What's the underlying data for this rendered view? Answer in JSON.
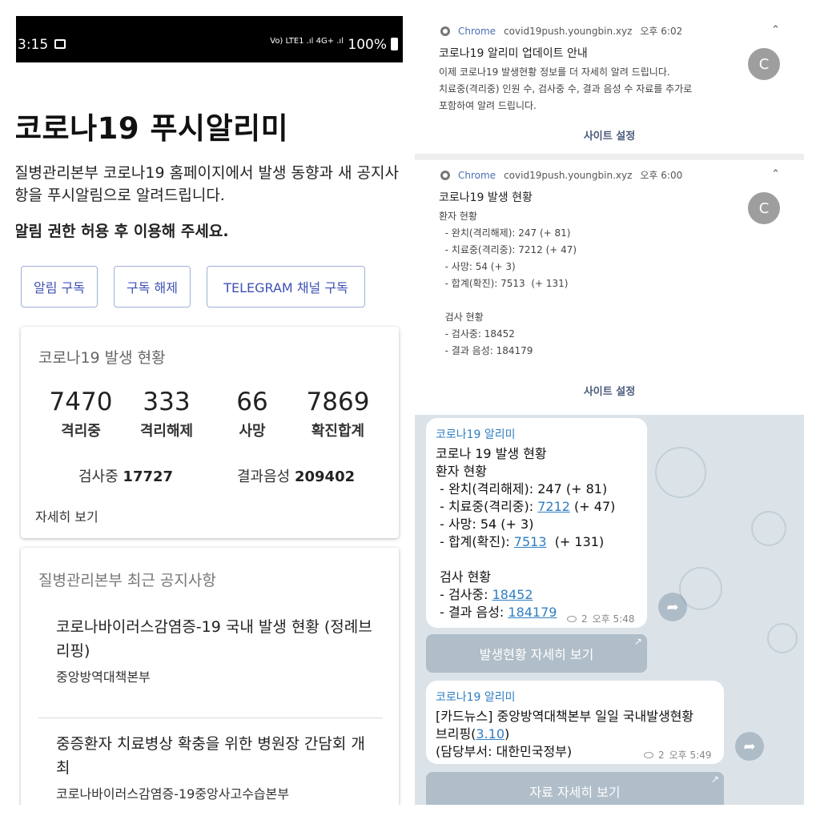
{
  "status_bar": {
    "time": "3:15",
    "signal_text": "Vo) LTE1 .ıl 4G+ .ıl",
    "battery": "100%"
  },
  "app": {
    "title": "코로나19 푸시알리미",
    "description": "질병관리본부 코로나19 홈페이지에서 발생 동향과 새 공지사항을 푸시알림으로 알려드립니다.",
    "permission_note": "알림 권한 허용 후 이용해 주세요.",
    "buttons": {
      "subscribe": "알림 구독",
      "unsubscribe": "구독 해제",
      "telegram": "TELEGRAM 채널 구독"
    }
  },
  "stats_card": {
    "title": "코로나19 발생 현황",
    "stats": [
      {
        "value": "7470",
        "label": "격리중"
      },
      {
        "value": "333",
        "label": "격리해제"
      },
      {
        "value": "66",
        "label": "사망"
      },
      {
        "value": "7869",
        "label": "확진합계"
      }
    ],
    "testing_label": "검사중",
    "testing_value": "17727",
    "negative_label": "결과음성",
    "negative_value": "209402",
    "more_link": "자세히 보기"
  },
  "notice_card": {
    "title": "질병관리본부 최근 공지사항",
    "items": [
      {
        "title": "코로나바이러스감염증-19 국내 발생 현황 (정례브리핑)",
        "source": "중앙방역대책본부"
      },
      {
        "title": "중증환자 치료병상 확충을 위한 병원장 간담회 개최",
        "source": "코로나바이러스감염증-19중앙사고수습본부"
      }
    ]
  },
  "notifications": [
    {
      "app": "Chrome",
      "site": "covid19push.youngbin.xyz",
      "time": "오후 6:02",
      "title": "코로나19 알리미 업데이트 안내",
      "body": "이제 코로나19 발생현황 정보를 더 자세히 알려 드립니다.\n치료중(격리중) 인원 수, 검사중 수, 결과 음성 수 자료를 추가로\n포함하여 알려 드립니다.",
      "avatar": "C",
      "action": "사이트 설정"
    },
    {
      "app": "Chrome",
      "site": "covid19push.youngbin.xyz",
      "time": "오후 6:00",
      "title": "코로나19 발생 현황",
      "body": "환자 현황\n  - 완치(격리해제): 247 (+ 81)\n  - 치료중(격리중): 7212 (+ 47)\n  - 사망: 54 (+ 3)\n  - 합계(확진): 7513  (+ 131)\n\n  검사 현황\n  - 검사중: 18452\n  - 결과 음성: 184179",
      "avatar": "C",
      "action": "사이트 설정"
    }
  ],
  "telegram": {
    "messages": [
      {
        "sender": "코로나19 알리미",
        "line1": "코로나 19 발생 현황",
        "line2": "환자 현황",
        "line3": " - 완치(격리해제): 247 (+ 81)",
        "line4_pre": " - 치료중(격리중): ",
        "line4_link": "7212",
        "line4_post": " (+ 47)",
        "line5": " - 사망: 54 (+ 3)",
        "line6_pre": " - 합계(확진): ",
        "line6_link": "7513",
        "line6_post": "  (+ 131)",
        "line7": " 검사 현황",
        "line8_pre": " - 검사중: ",
        "line8_link": "18452",
        "line9_pre": " - 결과 음성: ",
        "line9_link": "184179",
        "views": "2",
        "time": "오후 5:48",
        "button": "발생현황 자세히 보기"
      },
      {
        "sender": "코로나19 알리미",
        "line1": "[카드뉴스] 중앙방역대책본부 일일 국내발생현황",
        "line2_pre": "브리핑(",
        "line2_link": "3.10",
        "line2_post": ")",
        "line3": "(담당부서: 대한민국정부)",
        "views": "2",
        "time": "오후 5:49",
        "button": "자료 자세히 보기"
      }
    ]
  }
}
